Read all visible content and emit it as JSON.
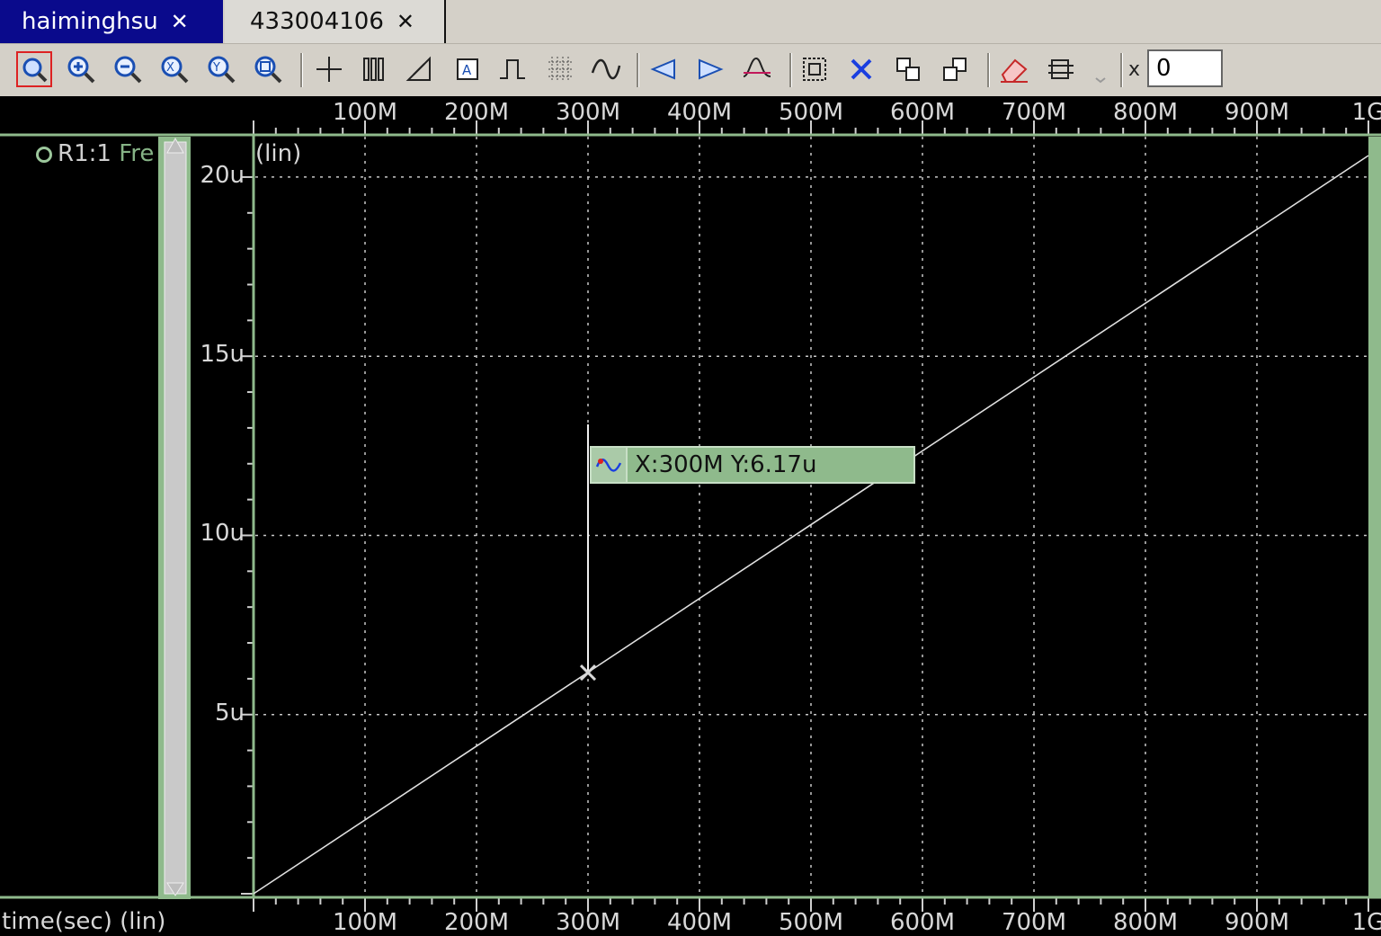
{
  "tabs": [
    {
      "label": "haiminghsu",
      "active": true
    },
    {
      "label": "433004106",
      "active": false
    }
  ],
  "toolbar": {
    "x_label": "x",
    "x_value": "0",
    "icons": [
      "zoom-fit-icon",
      "zoom-in-icon",
      "zoom-out-icon",
      "zoom-x-icon",
      "zoom-y-icon",
      "zoom-area-icon",
      "crosshair-icon",
      "vertical-markers-icon",
      "delta-measure-icon",
      "annotation-icon",
      "pulse-marker-icon",
      "grid-toggle-icon",
      "waveform-marker-icon",
      "previous-icon",
      "next-icon",
      "peak-icon",
      "select-region-icon",
      "delete-icon",
      "copy-icon",
      "paste-icon",
      "eraser-icon",
      "axis-config-icon"
    ]
  },
  "legend": {
    "prefix": "R1:1",
    "name": "Fre"
  },
  "plot": {
    "y_scale_label": "(lin)",
    "x_axis_title": "time(sec) (lin)"
  },
  "cursor_tooltip": {
    "text": "X:300M Y:6.17u"
  },
  "colors": {
    "accent_tab": "#0a0a8c",
    "trace": "#e0e0e0",
    "grid": "#c8c8c8",
    "plot_border": "#8fba8c",
    "tooltip_bg": "#8fba8c"
  },
  "chart_data": {
    "type": "line",
    "x_scale": "linear",
    "y_scale": "linear",
    "xlim": [
      0,
      1000000000
    ],
    "ylim": [
      0,
      20.5
    ],
    "x_ticks": [
      100000000,
      200000000,
      300000000,
      400000000,
      500000000,
      600000000,
      700000000,
      800000000,
      900000000,
      1000000000
    ],
    "x_tick_labels": [
      "100M",
      "200M",
      "300M",
      "400M",
      "500M",
      "600M",
      "700M",
      "800M",
      "900M",
      "1G"
    ],
    "y_ticks": [
      5,
      10,
      15,
      20
    ],
    "y_tick_labels": [
      "5u",
      "10u",
      "15u",
      "20u"
    ],
    "grid": true,
    "series": [
      {
        "name": "R1:1 Fre",
        "x": [
          0,
          1000000000
        ],
        "y": [
          0,
          20.6
        ]
      }
    ],
    "marker": {
      "x": 300000000,
      "y": 6.17
    }
  }
}
